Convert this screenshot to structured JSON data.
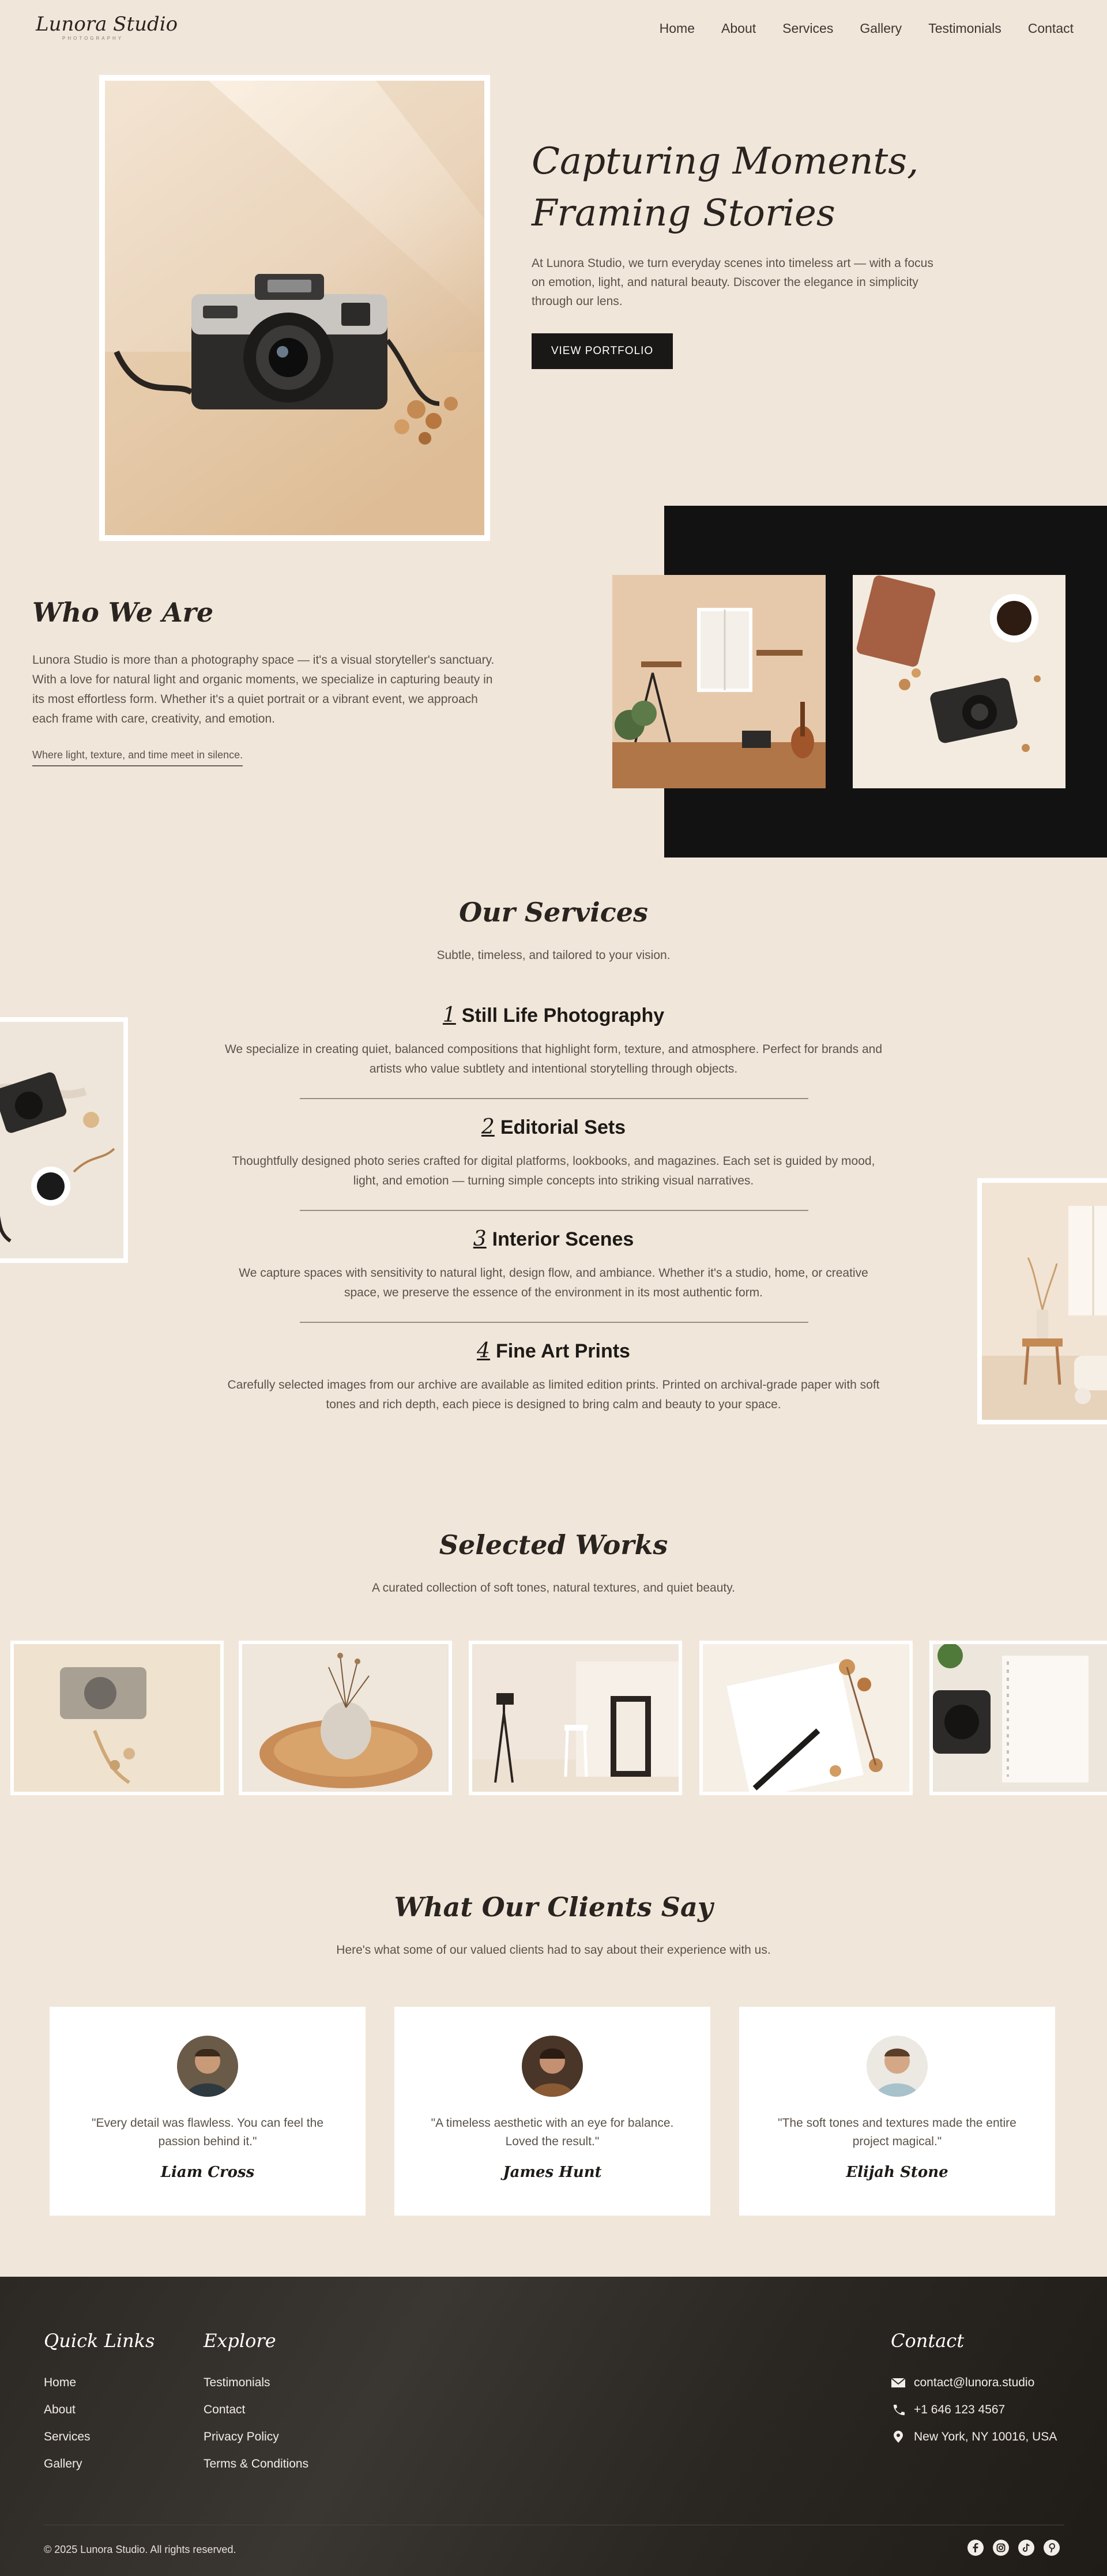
{
  "header": {
    "logo": "Lunora Studio",
    "logo_sub": "PHOTOGRAPHY",
    "nav": [
      "Home",
      "About",
      "Services",
      "Gallery",
      "Testimonials",
      "Contact"
    ]
  },
  "hero": {
    "title_line1": "Capturing Moments,",
    "title_line2": "Framing Stories",
    "description": "At Lunora Studio, we turn everyday scenes into timeless art — with a focus on emotion, light, and natural beauty. Discover the elegance in simplicity through our lens.",
    "button": "VIEW PORTFOLIO"
  },
  "who": {
    "title": "Who We Are",
    "text": "Lunora Studio is more than a photography space — it's a visual storyteller's sanctuary. With a love for natural light and organic moments, we specialize in capturing beauty in its most effortless form. Whether it's a quiet portrait or a vibrant event, we approach each frame with care, creativity, and emotion.",
    "tagline": "Where light, texture, and time meet in silence."
  },
  "services": {
    "title": "Our Services",
    "subtitle": "Subtle, timeless, and tailored to your vision.",
    "items": [
      {
        "num": "1",
        "name": "Still Life Photography",
        "text": "We specialize in creating quiet, balanced compositions that highlight form, texture, and atmosphere. Perfect for brands and artists who value subtlety and intentional storytelling through objects."
      },
      {
        "num": "2",
        "name": "Editorial Sets",
        "text": "Thoughtfully designed photo series crafted for digital platforms, lookbooks, and magazines. Each set is guided by mood, light, and emotion — turning simple concepts into striking visual narratives."
      },
      {
        "num": "3",
        "name": "Interior Scenes",
        "text": "We capture spaces with sensitivity to natural light, design flow, and ambiance. Whether it's a studio, home, or creative space, we preserve the essence of the environment in its most authentic form."
      },
      {
        "num": "4",
        "name": "Fine Art Prints",
        "text": "Carefully selected images from our archive are available as limited edition prints. Printed on archival-grade paper with soft tones and rich depth, each piece is designed to bring calm and beauty to your space."
      }
    ]
  },
  "works": {
    "title": "Selected Works",
    "subtitle": "A curated collection of soft tones, natural textures, and quiet beauty."
  },
  "testimonials": {
    "title": "What Our Clients Say",
    "subtitle": "Here's what some of our valued clients had to say about their experience with us.",
    "items": [
      {
        "quote": "\"Every detail was flawless. You can feel the passion behind it.\"",
        "name": "Liam Cross"
      },
      {
        "quote": "\"A timeless aesthetic with an eye for balance. Loved the result.\"",
        "name": "James Hunt"
      },
      {
        "quote": "\"The soft tones and textures made the entire project magical.\"",
        "name": "Elijah Stone"
      }
    ]
  },
  "footer": {
    "quick_title": "Quick Links",
    "quick_links": [
      "Home",
      "About",
      "Services",
      "Gallery"
    ],
    "explore_title": "Explore",
    "explore_links": [
      "Testimonials",
      "Contact",
      "Privacy Policy",
      "Terms & Conditions"
    ],
    "contact_title": "Contact",
    "email": "contact@lunora.studio",
    "phone": "+1 646 123 4567",
    "address": "New York, NY 10016, USA",
    "copyright": "© 2025 Lunora Studio. All rights reserved."
  }
}
